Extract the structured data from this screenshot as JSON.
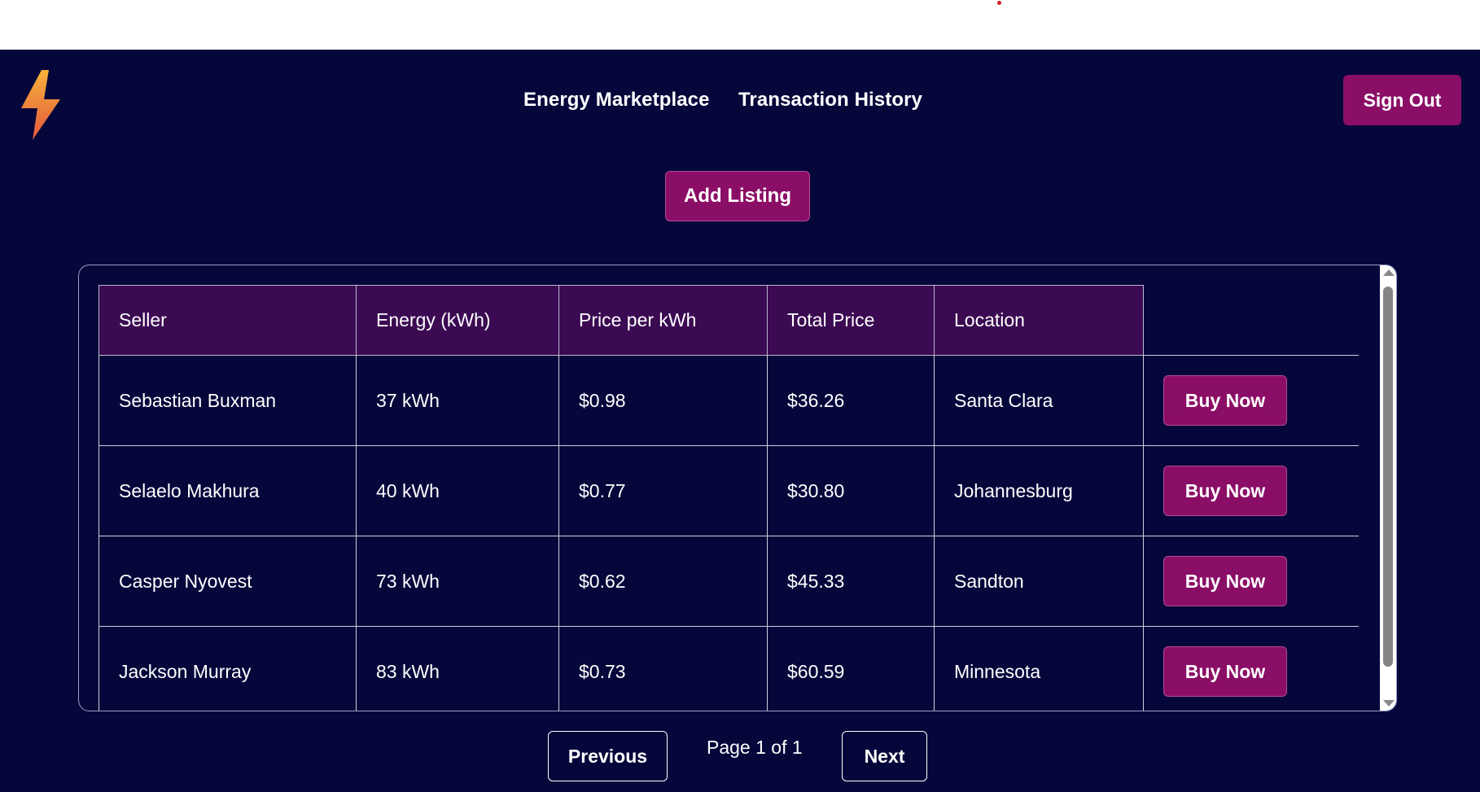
{
  "nav": {
    "links": [
      "Energy Marketplace",
      "Transaction History"
    ],
    "sign_out": "Sign Out"
  },
  "actions": {
    "add_listing": "Add Listing"
  },
  "table": {
    "headers": [
      "Seller",
      "Energy (kWh)",
      "Price per kWh",
      "Total Price",
      "Location"
    ],
    "rows": [
      {
        "seller": "Sebastian Buxman",
        "energy": "37 kWh",
        "price": "$0.98",
        "total": "$36.26",
        "location": "Santa Clara",
        "action": "Buy Now"
      },
      {
        "seller": "Selaelo Makhura",
        "energy": "40 kWh",
        "price": "$0.77",
        "total": "$30.80",
        "location": "Johannesburg",
        "action": "Buy Now"
      },
      {
        "seller": "Casper Nyovest",
        "energy": "73 kWh",
        "price": "$0.62",
        "total": "$45.33",
        "location": "Sandton",
        "action": "Buy Now"
      },
      {
        "seller": "Jackson Murray",
        "energy": "83 kWh",
        "price": "$0.73",
        "total": "$60.59",
        "location": "Minnesota",
        "action": "Buy Now"
      }
    ]
  },
  "pagination": {
    "previous": "Previous",
    "page_info": "Page 1 of 1",
    "next": "Next"
  },
  "colors": {
    "background": "#05063a",
    "accent": "#8b0e66",
    "header_bg": "#3b0a52"
  },
  "icons": {
    "logo": "lightning-bolt-icon"
  }
}
